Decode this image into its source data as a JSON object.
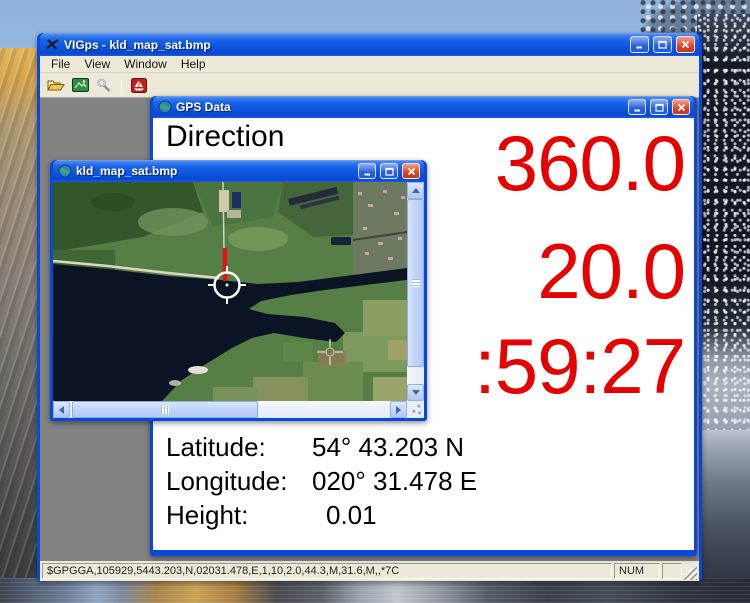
{
  "app": {
    "window_title": "VIGps - kld_map_sat.bmp",
    "menu_items": [
      "File",
      "View",
      "Window",
      "Help"
    ],
    "status": {
      "nmea_sentence": "$GPGGA,105929,5443.203,N,02031.478,E,1,10,2.0,44.3,M,31.6,M,,*7C",
      "num_indicator": "NUM"
    }
  },
  "gps_window": {
    "title": "GPS Data",
    "direction_label": "Direction",
    "direction_value": "360.0",
    "speed_value": "20.0",
    "time_value": ":59:27",
    "value_color": "#e60000",
    "coords": [
      {
        "label": "Latitude:",
        "value": "54° 43.203 N"
      },
      {
        "label": "Longitude:",
        "value": "020° 31.478 E"
      },
      {
        "label": "Height:",
        "value": "0.01"
      }
    ]
  },
  "map_window": {
    "title": "kld_map_sat.bmp"
  }
}
